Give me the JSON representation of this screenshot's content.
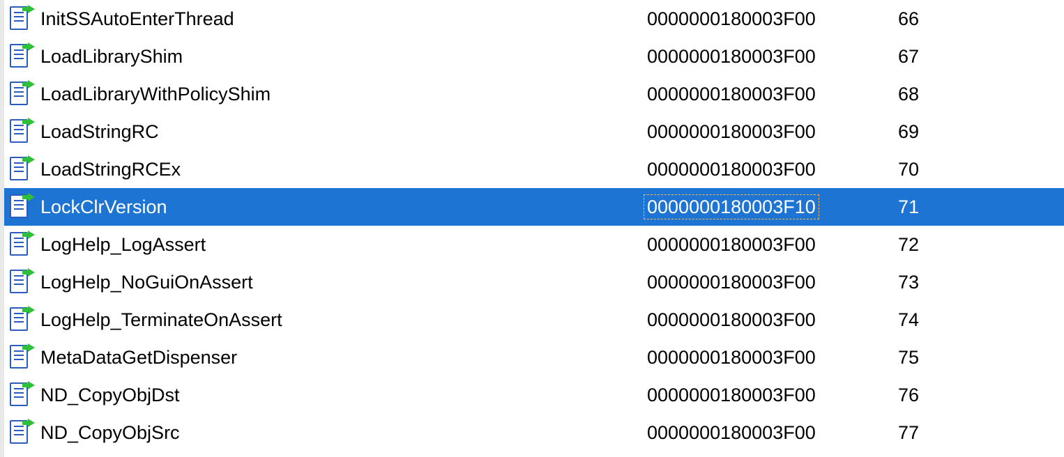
{
  "list": {
    "items": [
      {
        "name": "InitSSAutoEnterThread",
        "address": "0000000180003F00",
        "ordinal": "66",
        "selected": false
      },
      {
        "name": "LoadLibraryShim",
        "address": "0000000180003F00",
        "ordinal": "67",
        "selected": false
      },
      {
        "name": "LoadLibraryWithPolicyShim",
        "address": "0000000180003F00",
        "ordinal": "68",
        "selected": false
      },
      {
        "name": "LoadStringRC",
        "address": "0000000180003F00",
        "ordinal": "69",
        "selected": false
      },
      {
        "name": "LoadStringRCEx",
        "address": "0000000180003F00",
        "ordinal": "70",
        "selected": false
      },
      {
        "name": "LockClrVersion",
        "address": "0000000180003F10",
        "ordinal": "71",
        "selected": true
      },
      {
        "name": "LogHelp_LogAssert",
        "address": "0000000180003F00",
        "ordinal": "72",
        "selected": false
      },
      {
        "name": "LogHelp_NoGuiOnAssert",
        "address": "0000000180003F00",
        "ordinal": "73",
        "selected": false
      },
      {
        "name": "LogHelp_TerminateOnAssert",
        "address": "0000000180003F00",
        "ordinal": "74",
        "selected": false
      },
      {
        "name": "MetaDataGetDispenser",
        "address": "0000000180003F00",
        "ordinal": "75",
        "selected": false
      },
      {
        "name": "ND_CopyObjDst",
        "address": "0000000180003F00",
        "ordinal": "76",
        "selected": false
      },
      {
        "name": "ND_CopyObjSrc",
        "address": "0000000180003F00",
        "ordinal": "77",
        "selected": false
      }
    ]
  }
}
